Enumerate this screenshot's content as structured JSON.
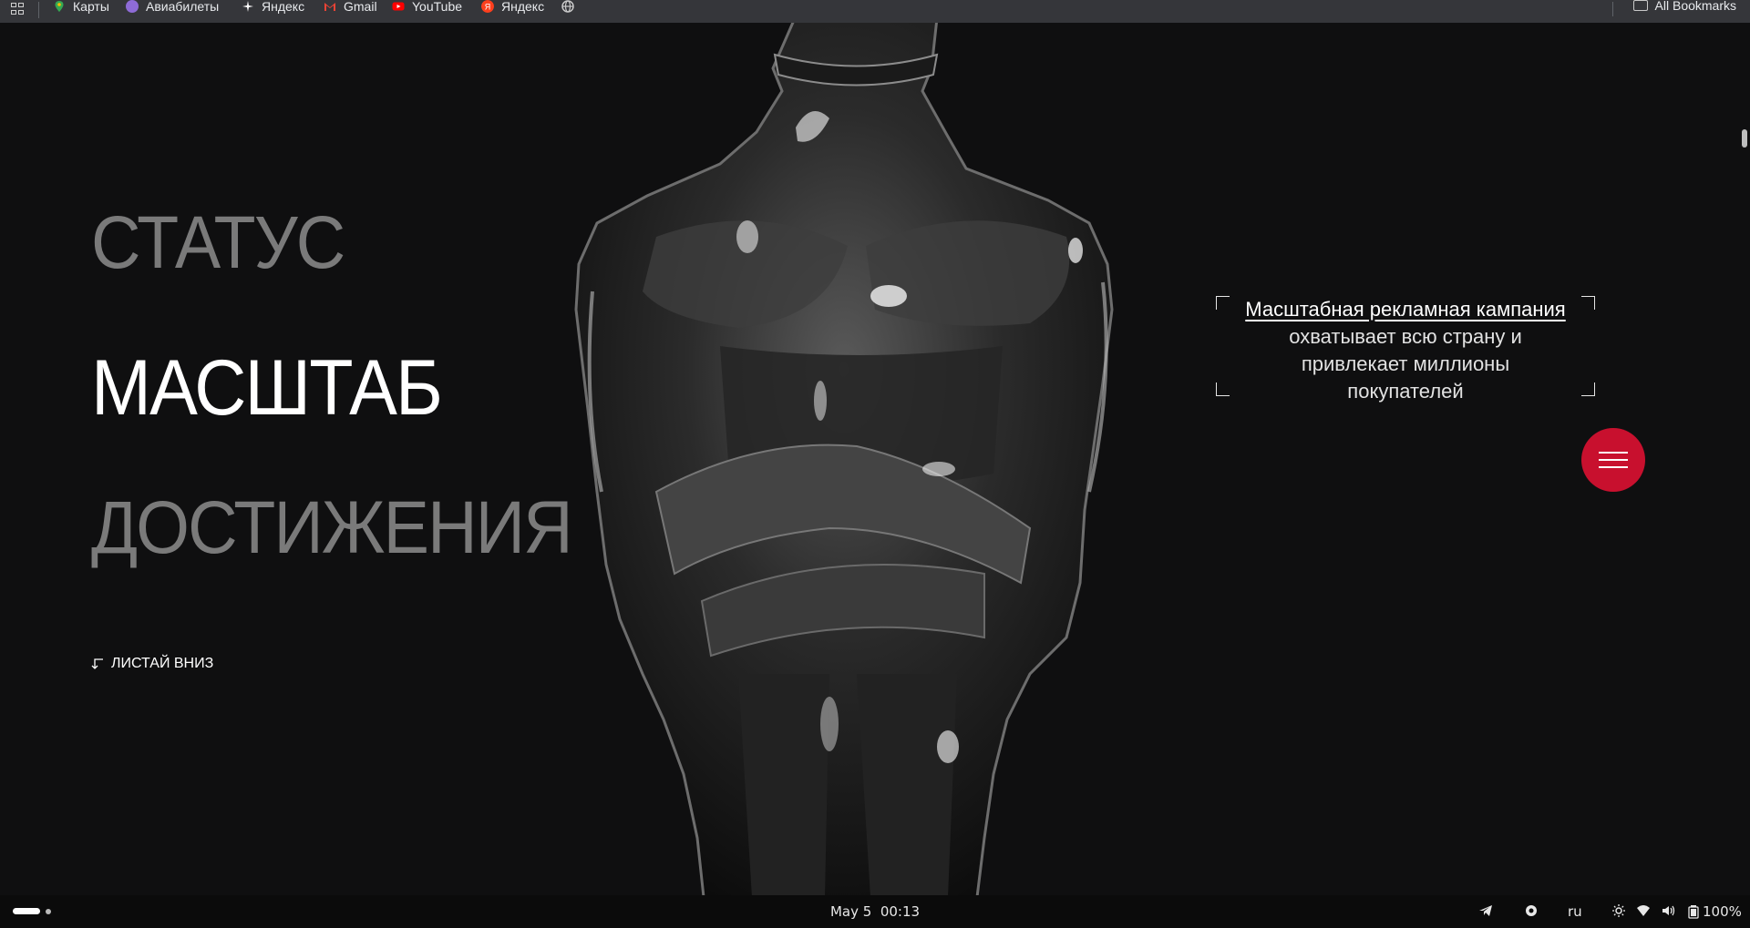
{
  "bookmarks_bar": {
    "items": [
      {
        "label": "Карты",
        "icon": "maps-pin-icon",
        "color": "#34a853"
      },
      {
        "label": "Авиабилеты",
        "icon": "aviasales-icon",
        "color": "#8e6bd6"
      },
      {
        "label": "Яндекс",
        "icon": "yandex-sparkle-icon",
        "color": "#ffffff"
      },
      {
        "label": "Gmail",
        "icon": "gmail-icon",
        "color": "#ea4335"
      },
      {
        "label": "YouTube",
        "icon": "youtube-icon",
        "color": "#ff0000"
      },
      {
        "label": "Яндекс",
        "icon": "yandex-icon",
        "color": "#fc3f1d"
      },
      {
        "label": "",
        "icon": "globe-icon",
        "color": "#c9c9c9"
      }
    ],
    "all_bookmarks_label": "All Bookmarks"
  },
  "hero": {
    "words": [
      "СТАТУС",
      "МАСШТАБ",
      "ДОСТИЖЕНИЯ"
    ],
    "active_word": "МАСШТАБ",
    "scroll_hint": "ЛИСТАЙ ВНИЗ",
    "caption_link": "Масштабная рекламная кампания",
    "caption_line1": "охватывает всю страну и",
    "caption_line2": "привлекает миллионы",
    "caption_line3": "покупателей",
    "accent_color": "#c8102e"
  },
  "taskbar": {
    "date": "May 5",
    "time": "00:13",
    "language": "ru",
    "battery": "100%"
  }
}
